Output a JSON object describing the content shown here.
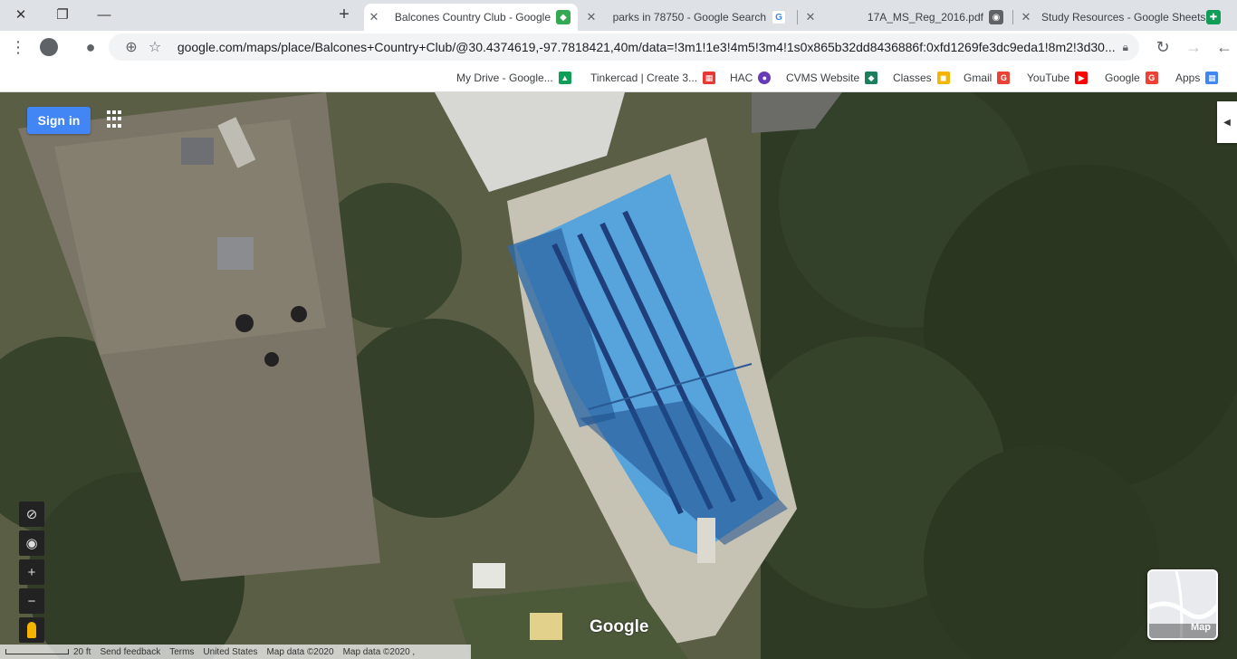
{
  "window_controls": {
    "close": "✕",
    "maximize": "❐",
    "minimize": "—"
  },
  "tabs": [
    {
      "title": "Study Resources - Google Sheets",
      "favicon": "sheets-icon",
      "color": "#0f9d58"
    },
    {
      "title": "17A_MS_Reg_2016.pdf",
      "favicon": "globe-icon",
      "color": "#5f6368"
    },
    {
      "title": "parks in 78750 - Google Search",
      "favicon": "google-icon",
      "color": "#4285f4"
    },
    {
      "title": "Balcones Country Club - Google",
      "favicon": "maps-icon",
      "color": "#34a853",
      "active": true
    }
  ],
  "new_tab": "+",
  "toolbar": {
    "url": "google.com/maps/place/Balcones+Country+Club/@30.4374619,-97.7818421,40m/data=!3m1!1e3!4m5!3m4!1s0x865b32dd8436886f:0xfd1269fe3dc9eda1!8m2!3d30..."
  },
  "bookmarks": [
    {
      "label": "Apps",
      "icon": "apps-icon",
      "color": "#4285f4"
    },
    {
      "label": "Google",
      "icon": "google-icon",
      "color": "#ea4335"
    },
    {
      "label": "YouTube",
      "icon": "youtube-icon",
      "color": "#ff0000"
    },
    {
      "label": "Gmail",
      "icon": "google-icon",
      "color": "#ea4335"
    },
    {
      "label": "Classes",
      "icon": "classroom-icon",
      "color": "#f4b400"
    },
    {
      "label": "CVMS Website",
      "icon": "cvms-icon",
      "color": "#1a7f5a"
    },
    {
      "label": "HAC",
      "icon": "hac-icon",
      "color": "#673ab7"
    },
    {
      "label": "Tinkercad | Create 3...",
      "icon": "tinkercad-icon",
      "color": "#e53935"
    },
    {
      "label": "My Drive - Google...",
      "icon": "drive-icon",
      "color": "#0f9d58"
    }
  ],
  "map": {
    "sign_in": "Sign in",
    "layer_label": "Map",
    "wordmark": "Google",
    "footer": {
      "scale": "20 ft",
      "send_feedback": "Send feedback",
      "terms": "Terms",
      "country": "United States",
      "map_data": "Map data ©2020",
      "imagery": "Map data ©2020 ,"
    }
  }
}
